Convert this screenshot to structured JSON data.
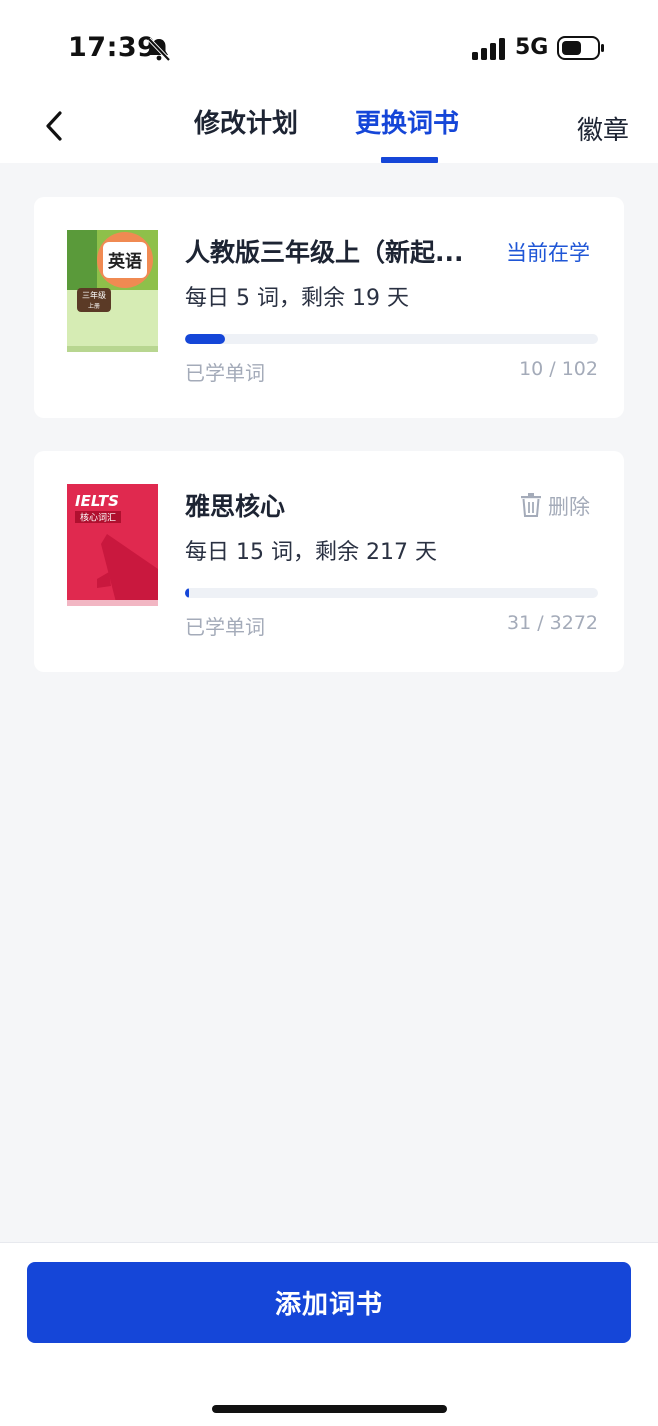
{
  "status": {
    "time": "17:39",
    "network": "5G"
  },
  "nav": {
    "tab_plan": "修改计划",
    "tab_book": "更换词书",
    "badge": "徽章"
  },
  "cover1": {
    "subject": "英语",
    "grade": "三年级",
    "volume": "上册"
  },
  "cover2": {
    "brand": "IELTS",
    "subtitle": "核心词汇"
  },
  "books": [
    {
      "title": "人教版三年级上（新起...",
      "action": "当前在学",
      "plan": "每日 5 词，剩余 19  天",
      "learned_label": "已学单词",
      "learned_count": "10 / 102",
      "progress": 0.098
    },
    {
      "title": "雅思核心",
      "action": "删除",
      "plan": "每日 15 词，剩余 217  天",
      "learned_label": "已学单词",
      "learned_count": "31 / 3272",
      "progress": 0.0095
    }
  ],
  "footer": {
    "add_button": "添加词书"
  },
  "colors": {
    "accent": "#1546d8",
    "muted": "#a4abb9",
    "action": "#1f56d6"
  }
}
